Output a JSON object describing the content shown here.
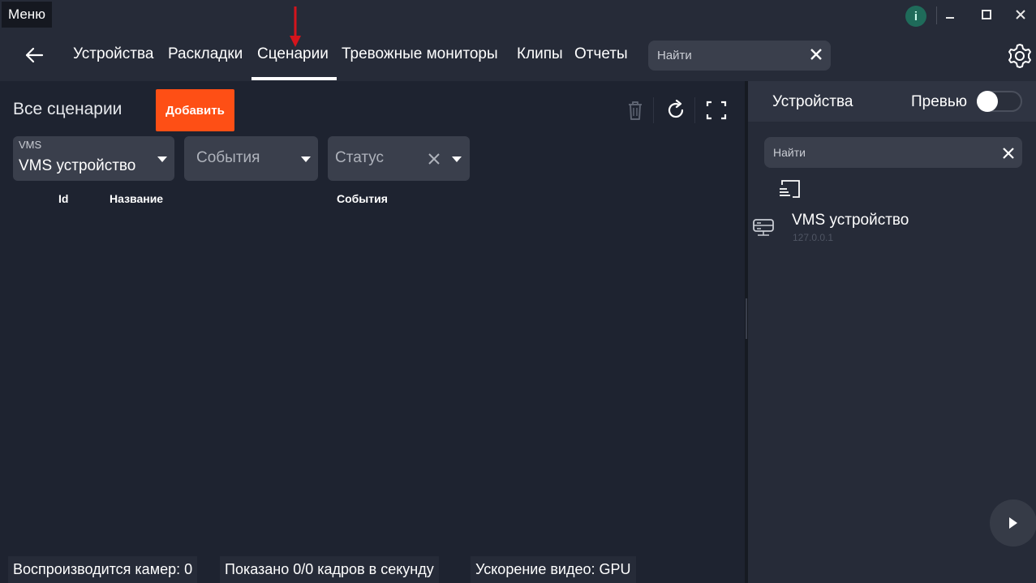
{
  "menu": {
    "label": "Меню"
  },
  "nav": {
    "tabs": [
      {
        "label": "Устройства"
      },
      {
        "label": "Раскладки"
      },
      {
        "label": "Сценарии",
        "active": true
      },
      {
        "label": "Тревожные мониторы"
      },
      {
        "label": "Клипы"
      },
      {
        "label": "Отчеты"
      }
    ],
    "search": {
      "placeholder": "Найти"
    }
  },
  "window_controls": {
    "info": "i"
  },
  "main": {
    "title": "Все сценарии",
    "add_button": "Добавить",
    "filters": {
      "vms": {
        "label": "VMS",
        "value": "VMS устройство"
      },
      "events": {
        "placeholder": "События"
      },
      "status": {
        "placeholder": "Статус"
      }
    },
    "columns": [
      "Id",
      "Название",
      "События"
    ]
  },
  "right_panel": {
    "title": "Устройства",
    "preview_label": "Превью",
    "preview_enabled": false,
    "search": {
      "placeholder": "Найти"
    },
    "devices": [
      {
        "name": "VMS устройство",
        "ip": "127.0.0.1"
      }
    ]
  },
  "status_bar": {
    "cameras": "Воспроизводится камер: 0",
    "frames": "Показано 0/0 кадров в секунду",
    "acceleration": "Ускорение видео: GPU"
  },
  "colors": {
    "accent": "#fe4f15",
    "background": "#1e2330",
    "panel": "#262b38",
    "annotation_arrow": "#d4141c"
  }
}
